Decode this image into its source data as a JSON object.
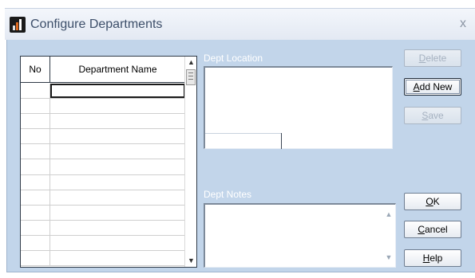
{
  "window": {
    "title": "Configure Departments",
    "close_glyph": "x",
    "icon": "app-chart-icon"
  },
  "grid": {
    "columns": [
      "No",
      "Department Name"
    ],
    "row_count": 12,
    "scroll_up_glyph": "▲",
    "scroll_down_glyph": "▼"
  },
  "fields": {
    "location_label": "Dept Location",
    "notes_label": "Dept Notes",
    "location_value": "",
    "notes_value": ""
  },
  "buttons": {
    "delete": {
      "pre": "",
      "mn": "D",
      "post": "elete"
    },
    "add_new": {
      "pre": "",
      "mn": "A",
      "post": "dd New"
    },
    "save": {
      "pre": "",
      "mn": "S",
      "post": "ave"
    },
    "ok": {
      "pre": "",
      "mn": "O",
      "post": "K"
    },
    "cancel": {
      "pre": "",
      "mn": "C",
      "post": "ancel"
    },
    "help": {
      "pre": "",
      "mn": "H",
      "post": "elp"
    }
  },
  "colors": {
    "client_background": "#c2d5ea",
    "title_text": "#3d4f6a",
    "label_text": "#ffffff",
    "disabled_text": "#a5b1c0"
  }
}
